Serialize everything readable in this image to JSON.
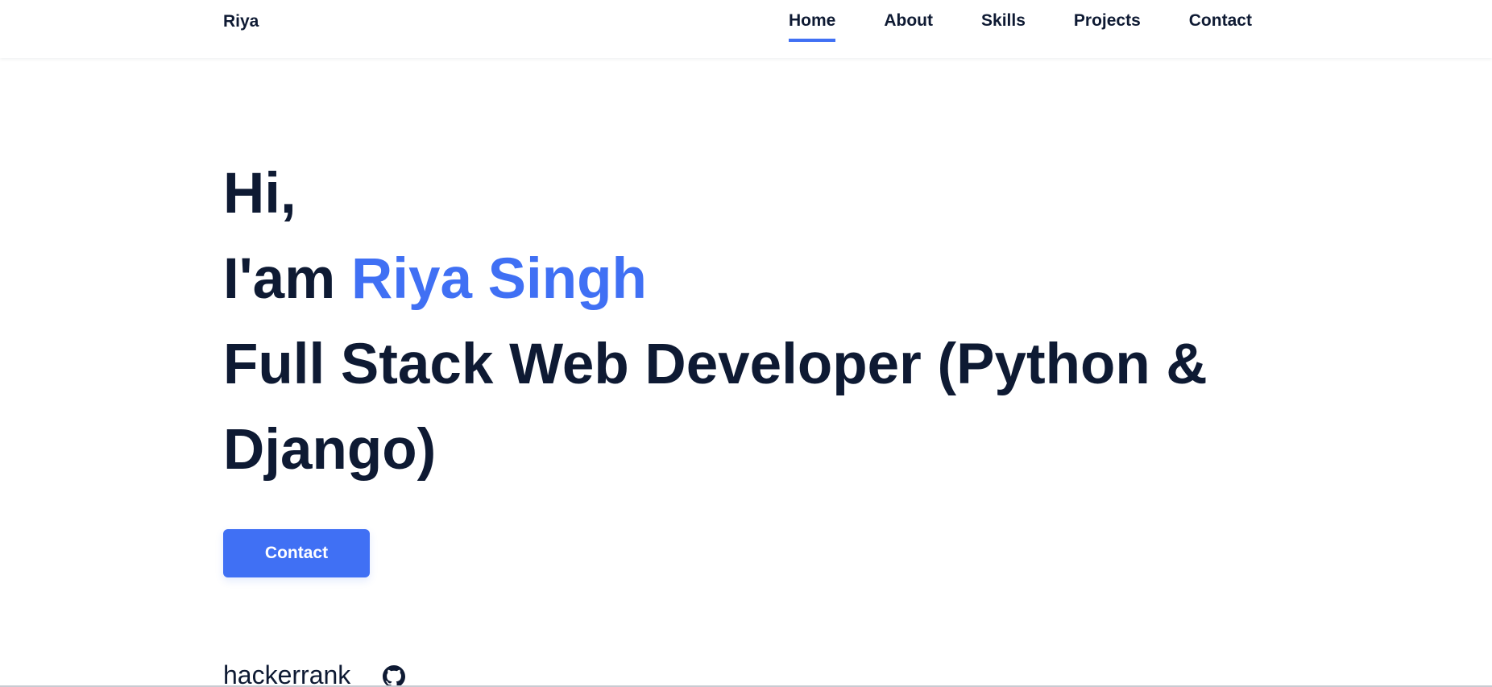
{
  "header": {
    "logo": "Riya",
    "nav": [
      {
        "label": "Home",
        "active": true
      },
      {
        "label": "About",
        "active": false
      },
      {
        "label": "Skills",
        "active": false
      },
      {
        "label": "Projects",
        "active": false
      },
      {
        "label": "Contact",
        "active": false
      }
    ]
  },
  "hero": {
    "greeting": "Hi,",
    "intro_prefix": "I'am ",
    "name": "Riya Singh",
    "role": "Full Stack Web Developer (Python & Django)",
    "button_label": "Contact"
  },
  "social": {
    "hackerrank_label": "hackerrank",
    "github_icon": "github-icon"
  },
  "colors": {
    "accent": "#4070f4",
    "text": "#0e1a33",
    "background": "#ffffff"
  }
}
